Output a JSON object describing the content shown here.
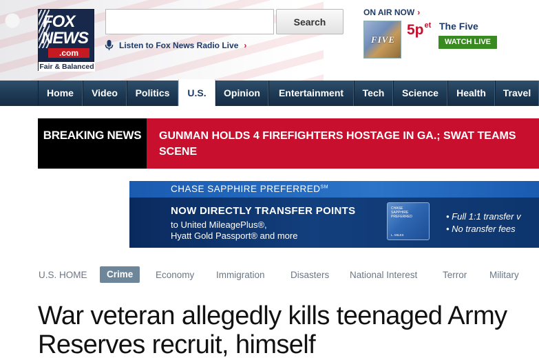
{
  "logo": {
    "line1": "FOX",
    "line2": "NEWS",
    "domain": ".com",
    "tagline": "Fair & Balanced"
  },
  "search": {
    "value": "",
    "placeholder": "",
    "button_label": "Search"
  },
  "radio": {
    "icon": "microphone-icon",
    "label": "Listen to Fox News Radio Live",
    "arrow": "›"
  },
  "on_air": {
    "label": "ON AIR NOW",
    "arrow": "›",
    "thumb_text": "FIVE",
    "time": "5p",
    "time_suffix": "et",
    "show_name": "The Five",
    "watch_label": "WATCH LIVE"
  },
  "nav": {
    "items": [
      {
        "label": "Home"
      },
      {
        "label": "Video"
      },
      {
        "label": "Politics"
      },
      {
        "label": "U.S.",
        "active": true
      },
      {
        "label": "Opinion"
      },
      {
        "label": "Entertainment"
      },
      {
        "label": "Tech"
      },
      {
        "label": "Science"
      },
      {
        "label": "Health"
      },
      {
        "label": "Travel"
      }
    ]
  },
  "breaking": {
    "label": "BREAKING NEWS",
    "text": "GUNMAN HOLDS 4 FIREFIGHTERS HOSTAGE IN GA.; SWAT TEAMS SCENE"
  },
  "ad": {
    "brand": "CHASE SAPPHIRE PREFERRED",
    "brand_mark": "SM",
    "headline": "NOW DIRECTLY TRANSFER POINTS",
    "sub1": "to United MileagePlus®,",
    "sub2": "Hyatt Gold Passport® and more",
    "card_line1": "CHASE",
    "card_line2": "SAPPHIRE",
    "card_line3": "PREFERRED",
    "card_name": "L. MILES",
    "bullet1": "• Full 1:1 transfer v",
    "bullet2": "• No transfer fees"
  },
  "subnav": {
    "items": [
      {
        "label": "U.S. HOME"
      },
      {
        "label": "Crime",
        "active": true
      },
      {
        "label": "Economy"
      },
      {
        "label": "Immigration"
      },
      {
        "label": "Disasters"
      },
      {
        "label": "National Interest"
      },
      {
        "label": "Terror"
      },
      {
        "label": "Military"
      }
    ]
  },
  "article": {
    "headline": "War veteran allegedly kills teenaged Army Reserves recruit, himself"
  },
  "colors": {
    "nav_bg": "#1d3954",
    "breaking_red": "#c8102e",
    "watch_green": "#3a8a22",
    "subnav_active": "#6e8699",
    "logo_navy": "#18284a"
  }
}
